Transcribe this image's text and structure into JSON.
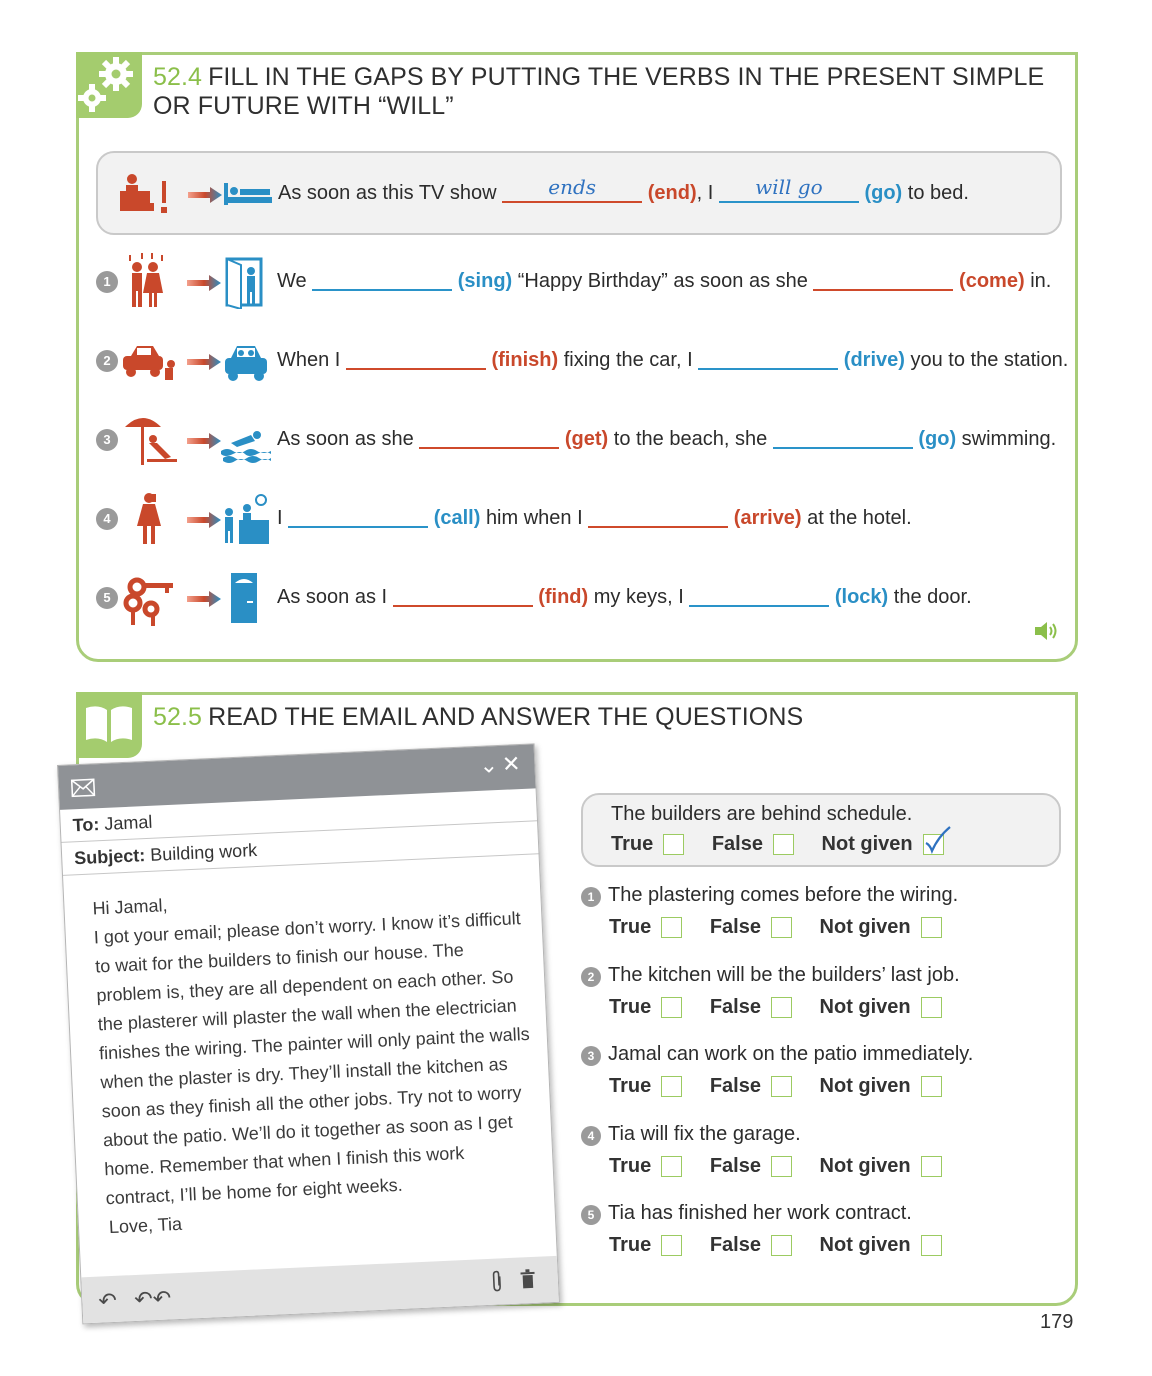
{
  "s524": {
    "number": "52.4",
    "title": "FILL IN THE GAPS BY PUTTING THE VERBS IN THE PRESENT SIMPLE OR FUTURE WITH “WILL”",
    "example": {
      "pre": "As soon as this TV show",
      "ans1": "ends",
      "verb1": "(end)",
      "mid": ", I",
      "ans2": "will go",
      "verb2": "(go)",
      "post": "to bed."
    },
    "items": [
      {
        "num": "1",
        "p1": "We",
        "v1": "(sing)",
        "p2": "“Happy Birthday” as soon as she",
        "v2": "(come)",
        "p3": "in."
      },
      {
        "num": "2",
        "p1": "When I",
        "v1": "(finish)",
        "p2": "fixing the car, I",
        "v2": "(drive)",
        "p3": "you to the station."
      },
      {
        "num": "3",
        "p1": "As soon as she",
        "v1": "(get)",
        "p2": "to the beach, she",
        "v2": "(go)",
        "p3": "swimming."
      },
      {
        "num": "4",
        "p1": "I",
        "v1": "(call)",
        "p2": "him when I",
        "v2": "(arrive)",
        "p3": "at the hotel."
      },
      {
        "num": "5",
        "p1": "As soon as I",
        "v1": "(find)",
        "p2": "my keys, I",
        "v2": "(lock)",
        "p3": "the door."
      }
    ]
  },
  "s525": {
    "number": "52.5",
    "title": "READ THE EMAIL AND ANSWER THE QUESTIONS",
    "email": {
      "to_label": "To:",
      "to": "Jamal",
      "subject_label": "Subject:",
      "subject": "Building work",
      "greeting": "Hi Jamal,",
      "body": "I got your email; please don’t worry. I know it’s difficult to wait for the builders to finish our house. The problem is, they are all dependent on each other. So the plasterer will plaster the wall when the electrician finishes the wiring. The painter will only paint the walls when the plaster is dry. They’ll install the kitchen as soon as they finish all the other jobs. Try not to worry about the patio. We’ll do it together as soon as I get home. Remember that when I finish this work contract, I’ll be home for eight weeks.",
      "signoff": "Love, Tia"
    },
    "options": {
      "true": "True",
      "false": "False",
      "not_given": "Not given"
    },
    "example_question": "The builders are behind schedule.",
    "questions": [
      {
        "num": "1",
        "text": "The plastering comes before the wiring."
      },
      {
        "num": "2",
        "text": "The kitchen will be the builders’ last job."
      },
      {
        "num": "3",
        "text": "Jamal can work on the patio immediately."
      },
      {
        "num": "4",
        "text": "Tia will fix the garage."
      },
      {
        "num": "5",
        "text": "Tia has finished her work contract."
      }
    ]
  },
  "page_number": "179",
  "colors": {
    "green": "#a4cc6e",
    "red": "#c9482b",
    "blue": "#2a8fc5"
  }
}
